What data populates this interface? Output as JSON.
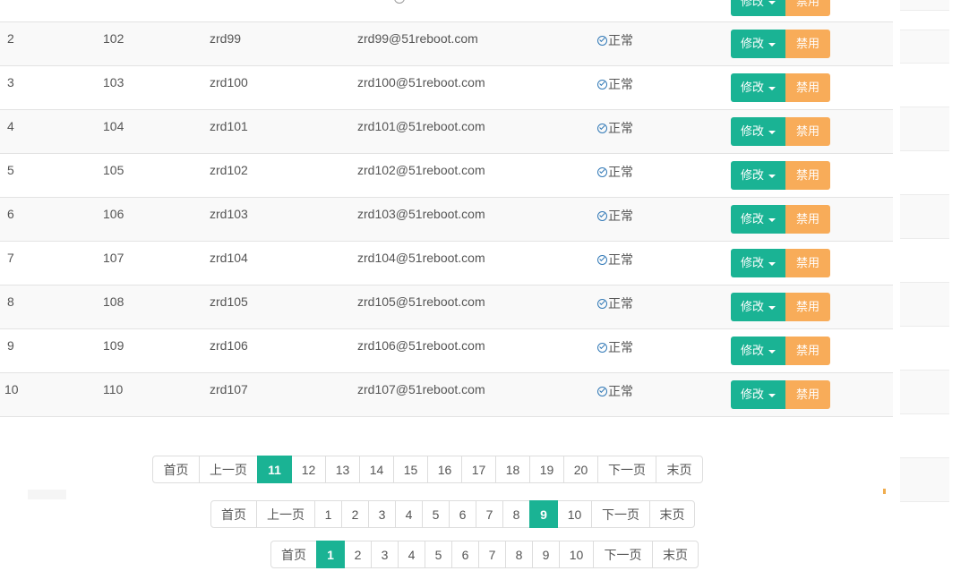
{
  "users": [
    {
      "idx": "2",
      "uid": "102",
      "name": "zrd99",
      "email": "zrd99@51reboot.com",
      "status": "正常"
    },
    {
      "idx": "3",
      "uid": "103",
      "name": "zrd100",
      "email": "zrd100@51reboot.com",
      "status": "正常"
    },
    {
      "idx": "4",
      "uid": "104",
      "name": "zrd101",
      "email": "zrd101@51reboot.com",
      "status": "正常"
    },
    {
      "idx": "5",
      "uid": "105",
      "name": "zrd102",
      "email": "zrd102@51reboot.com",
      "status": "正常"
    },
    {
      "idx": "6",
      "uid": "106",
      "name": "zrd103",
      "email": "zrd103@51reboot.com",
      "status": "正常"
    },
    {
      "idx": "7",
      "uid": "107",
      "name": "zrd104",
      "email": "zrd104@51reboot.com",
      "status": "正常"
    },
    {
      "idx": "8",
      "uid": "108",
      "name": "zrd105",
      "email": "zrd105@51reboot.com",
      "status": "正常"
    },
    {
      "idx": "9",
      "uid": "109",
      "name": "zrd106",
      "email": "zrd106@51reboot.com",
      "status": "正常"
    },
    {
      "idx": "10",
      "uid": "110",
      "name": "zrd107",
      "email": "zrd107@51reboot.com",
      "status": "正常"
    }
  ],
  "actions": {
    "edit": "修改",
    "ban": "禁用"
  },
  "status_icon": "check-circle-icon",
  "colors": {
    "edit": "#1ab394",
    "ban": "#f8ac59",
    "active_page": "#1ab394",
    "status_icon": "#337ab7"
  },
  "pagers": [
    {
      "first": "首页",
      "prev": "上一页",
      "pages": [
        "11",
        "12",
        "13",
        "14",
        "15",
        "16",
        "17",
        "18",
        "19",
        "20"
      ],
      "active": "11",
      "next": "下一页",
      "last": "末页"
    },
    {
      "first": "首页",
      "prev": "上一页",
      "pages": [
        "1",
        "2",
        "3",
        "4",
        "5",
        "6",
        "7",
        "8",
        "9",
        "10"
      ],
      "active": "9",
      "next": "下一页",
      "last": "末页"
    },
    {
      "first": "首页",
      "prev": null,
      "pages": [
        "1",
        "2",
        "3",
        "4",
        "5",
        "6",
        "7",
        "8",
        "9",
        "10"
      ],
      "active": "1",
      "next": "下一页",
      "last": "末页"
    }
  ]
}
